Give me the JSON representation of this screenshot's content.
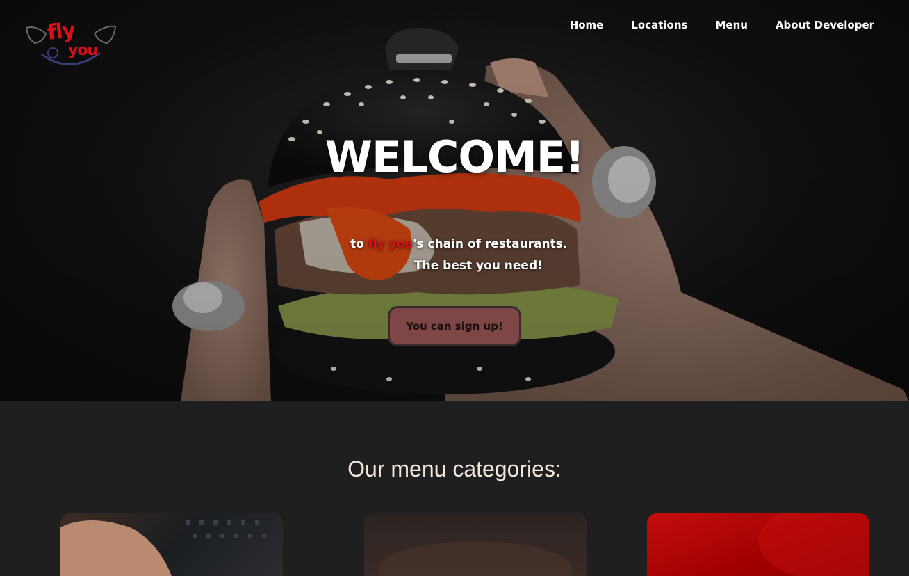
{
  "brand": {
    "logo_top": "fly",
    "logo_bottom": "you",
    "logo_color": "#d9101a"
  },
  "nav": {
    "items": [
      {
        "label": "Home"
      },
      {
        "label": "Locations"
      },
      {
        "label": "Menu"
      },
      {
        "label": "About Developer"
      }
    ]
  },
  "hero": {
    "heading": "WELCOME!",
    "tagline_prefix": "to ",
    "tagline_brand": "fly you",
    "tagline_suffix": "'s chain of restaurants.",
    "tagline_line2": "The best you need!",
    "signup_label": "You can sign up!",
    "background_image": "burger-hero-photo"
  },
  "categories": {
    "title": "Our menu categories:",
    "cards": [
      {
        "image": "category-photo-1"
      },
      {
        "image": "category-photo-2"
      },
      {
        "image": "category-photo-3"
      }
    ]
  },
  "colors": {
    "accent": "#d9101a",
    "button_bg": "#7e4646",
    "section_bg": "#1f1f1f"
  }
}
